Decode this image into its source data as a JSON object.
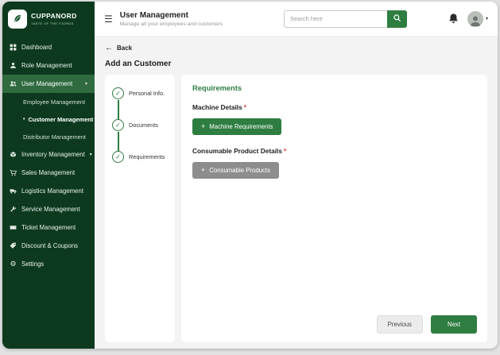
{
  "brand": {
    "name": "CUPPANORD",
    "tagline": "TASTE OF THE FJORDS"
  },
  "icons": {
    "hamburger": "☰",
    "back_arrow": "←",
    "chevron_down": "▾",
    "check": "✓",
    "plus": "+",
    "bullet": "•",
    "gear": "⚙"
  },
  "header": {
    "title": "User Management",
    "subtitle": "Manage all your employees and customers",
    "search": {
      "placeholder": "Search here"
    }
  },
  "sidebar": {
    "items": [
      {
        "label": "Dashboard"
      },
      {
        "label": "Role Management"
      },
      {
        "label": "User Management",
        "expanded": true,
        "children": [
          {
            "label": "Employee Management"
          },
          {
            "label": "Customer Management",
            "active": true
          },
          {
            "label": "Distributor Management"
          }
        ]
      },
      {
        "label": "Inventory Management"
      },
      {
        "label": "Sales Management"
      },
      {
        "label": "Logistics Management"
      },
      {
        "label": "Service Management"
      },
      {
        "label": "Ticket Management"
      },
      {
        "label": "Discount & Coupons"
      },
      {
        "label": "Settings"
      }
    ]
  },
  "page": {
    "back_label": "Back",
    "title": "Add an Customer"
  },
  "stepper": {
    "steps": [
      {
        "label": "Personal Info.",
        "state": "complete"
      },
      {
        "label": "Documents",
        "state": "complete"
      },
      {
        "label": "Requirements",
        "state": "complete"
      }
    ]
  },
  "content": {
    "section_title": "Requirements",
    "fields": [
      {
        "label": "Machine Details",
        "required": "*",
        "button": "Machine Requirements",
        "style": "green"
      },
      {
        "label": "Consumable Product Details",
        "required": "*",
        "button": "Consumable Products",
        "style": "gray"
      }
    ]
  },
  "footer": {
    "previous": "Previous",
    "next": "Next"
  },
  "colors": {
    "sidebar": "#0d3a1f",
    "active_item": "#2f6b3f",
    "accent": "#2e7d41",
    "gray_button": "#8d8d8d",
    "required": "#e53935"
  }
}
